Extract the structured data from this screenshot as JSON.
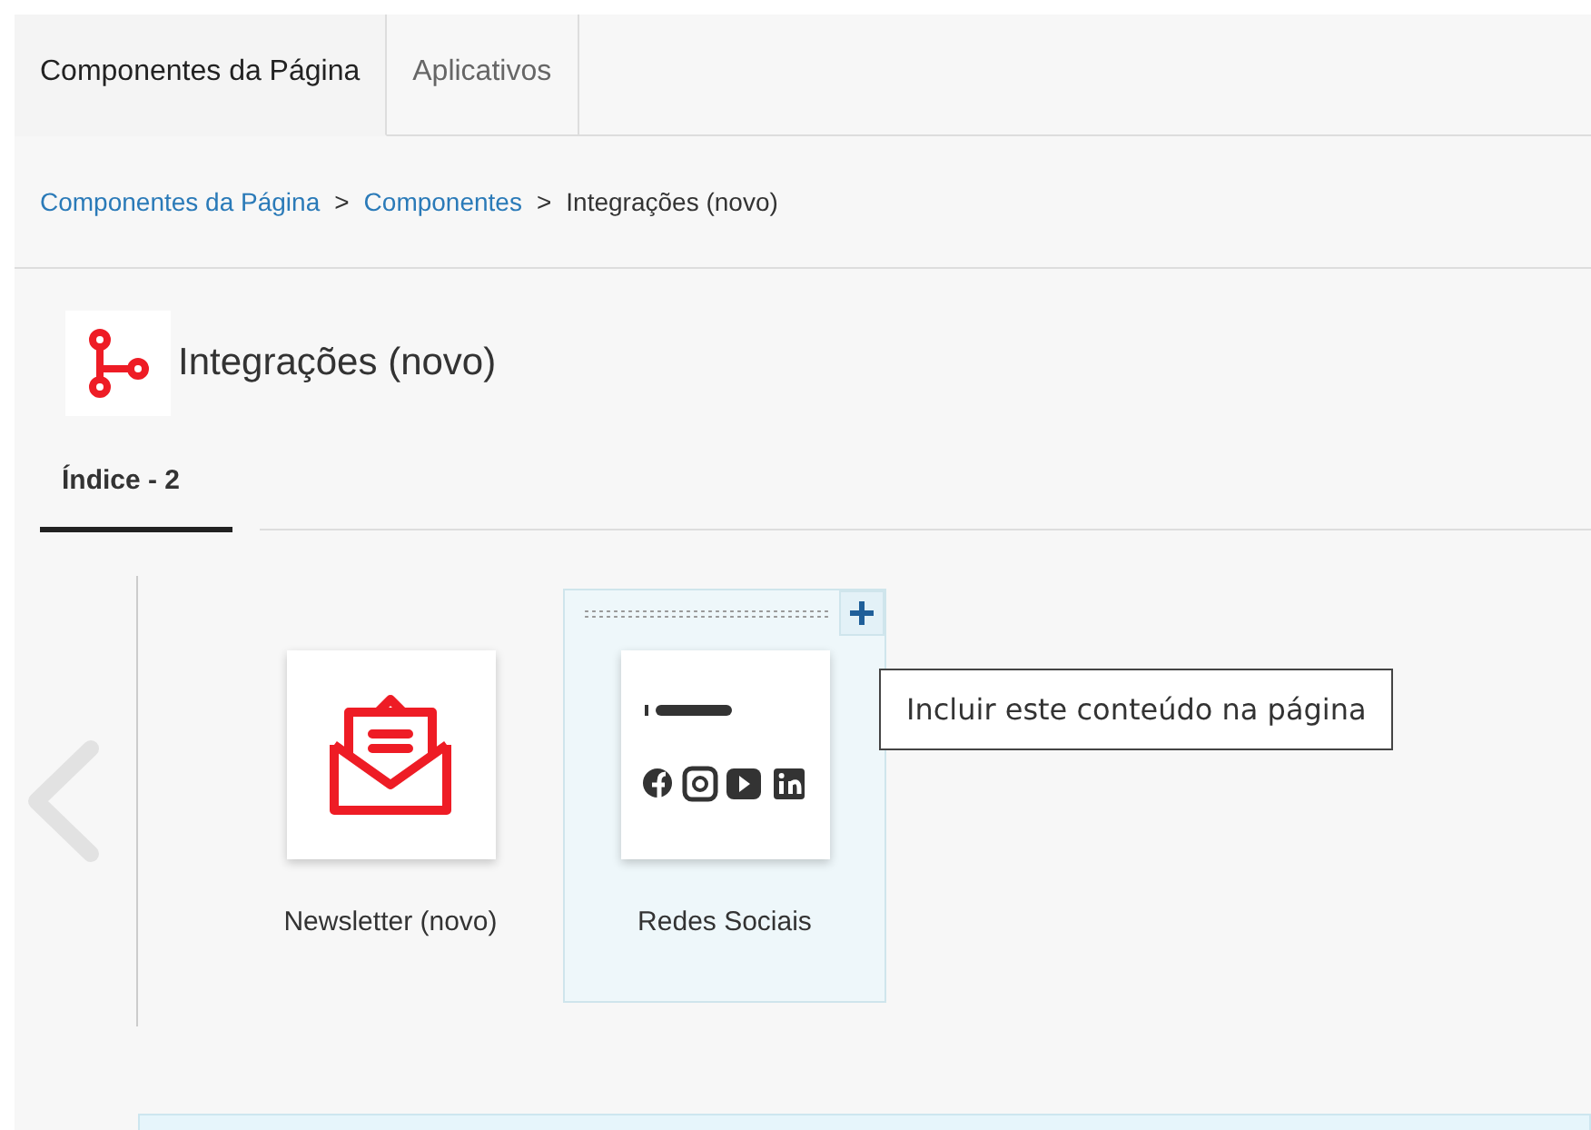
{
  "tabs": [
    {
      "label": "Componentes da Página",
      "selected": true
    },
    {
      "label": "Aplicativos",
      "selected": false
    }
  ],
  "breadcrumb": [
    {
      "label": "Componentes da Página",
      "kind": "link"
    },
    {
      "label": ">",
      "kind": "separator"
    },
    {
      "label": "Componentes",
      "kind": "link"
    },
    {
      "label": ">",
      "kind": "separator"
    },
    {
      "label": "Integrações (novo)",
      "kind": "current"
    }
  ],
  "heading": {
    "title": "Integrações (novo)"
  },
  "index_tabs": [
    {
      "label": "Índice - 2",
      "selected": true
    }
  ],
  "components": [
    {
      "label": "Newsletter (novo)",
      "kind": "newsletter",
      "selected": false
    },
    {
      "label": "Redes Sociais",
      "kind": "social",
      "selected": true
    }
  ],
  "tooltip": {
    "text": "Incluir este conteúdo na página"
  }
}
